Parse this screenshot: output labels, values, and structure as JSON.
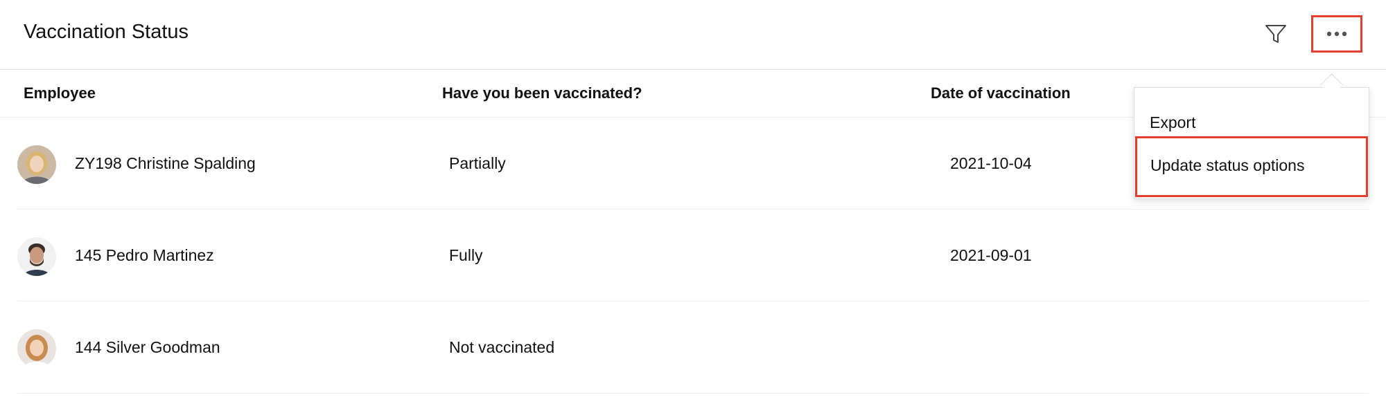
{
  "header": {
    "title": "Vaccination Status",
    "filter_icon": "filter-icon",
    "more_icon": "more-horizontal-icon"
  },
  "table": {
    "columns": [
      "Employee",
      "Have you been vaccinated?",
      "Date of vaccination"
    ],
    "rows": [
      {
        "employee": "ZY198 Christine Spalding",
        "vaccinated": "Partially",
        "date": "2021-10-04",
        "avatar": "avatar-photo"
      },
      {
        "employee": "145 Pedro Martinez",
        "vaccinated": "Fully",
        "date": "2021-09-01",
        "avatar": "avatar-photo"
      },
      {
        "employee": "144 Silver Goodman",
        "vaccinated": "Not vaccinated",
        "date": "",
        "avatar": "avatar-photo"
      }
    ]
  },
  "menu": {
    "items": [
      "Export",
      "Update status options"
    ]
  },
  "colors": {
    "highlight": "#e2402b",
    "divider": "#ececec",
    "text": "#111111"
  }
}
